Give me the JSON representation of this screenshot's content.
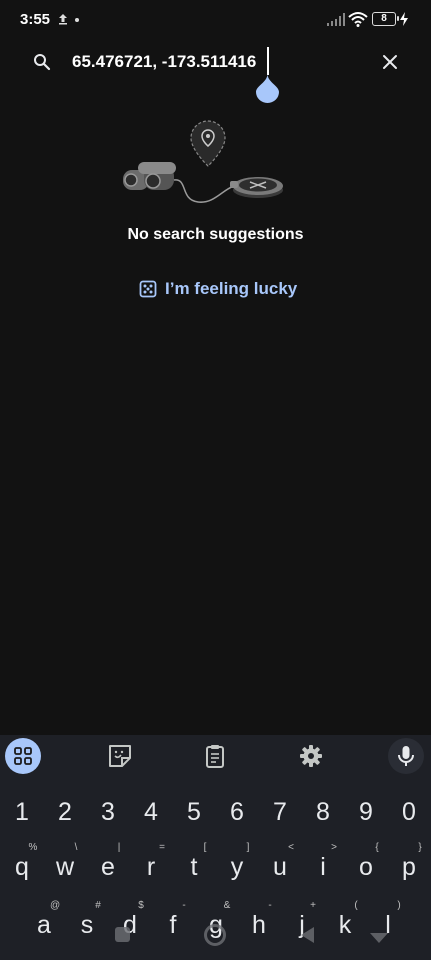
{
  "status_bar": {
    "time": "3:55",
    "battery": "8"
  },
  "search": {
    "query": "65.476721, -173.511416"
  },
  "empty_state": {
    "message": "No search suggestions",
    "lucky_label": "I’m feeling lucky"
  },
  "keyboard": {
    "toolbar": [
      "apps-icon",
      "sticker-icon",
      "clipboard-icon",
      "gear-icon",
      "microphone-icon"
    ],
    "number_row": [
      "1",
      "2",
      "3",
      "4",
      "5",
      "6",
      "7",
      "8",
      "9",
      "0"
    ],
    "letter_row_1": [
      "q",
      "w",
      "e",
      "r",
      "t",
      "y",
      "u",
      "i",
      "o",
      "p"
    ],
    "letter_row_1_hints": [
      "%",
      "\\",
      "|",
      "=",
      "[",
      "]",
      "<",
      ">",
      "{",
      "}"
    ],
    "letter_row_2": [
      "a",
      "s",
      "d",
      "f",
      "g",
      "h",
      "j",
      "k",
      "l"
    ],
    "letter_row_2_hints": [
      "@",
      "#",
      "$",
      "-",
      "&",
      "-",
      "+",
      "(",
      ")"
    ]
  },
  "colors": {
    "background": "#121212",
    "accent": "#a8c7fa",
    "keyboard_bg": "#1e2026"
  }
}
